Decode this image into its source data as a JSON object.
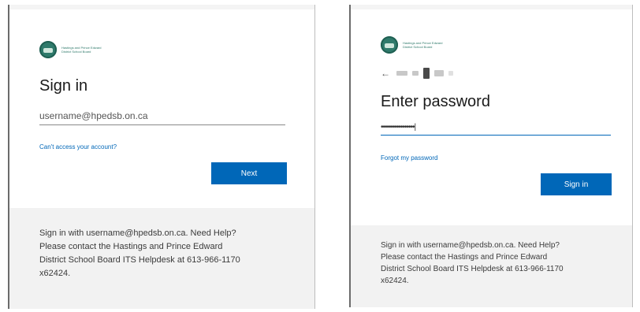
{
  "left_dialog": {
    "logo": {
      "icon": "school-board-logo-icon",
      "lines": [
        "Hastings and Prince Edward",
        "District School Board"
      ]
    },
    "title": "Sign in",
    "username_value": "username@hpedsb.on.ca",
    "cant_access_link": "Can't access your account?",
    "next_button": "Next",
    "footer_lines": [
      "Sign in with username@hpedsb.on.ca. Need Help?",
      "Please contact the Hastings and Prince Edward",
      "District School Board ITS Helpdesk at 613-966-1170",
      "x62424."
    ]
  },
  "right_dialog": {
    "logo": {
      "icon": "school-board-logo-icon",
      "lines": [
        "Hastings and Prince Edward",
        "District School Board"
      ]
    },
    "back_arrow": "←",
    "title": "Enter password",
    "password_value": "•••••••••••••••••",
    "forgot_password_link": "Forgot my password",
    "sign_in_button": "Sign in",
    "footer_lines": [
      "Sign in with username@hpedsb.on.ca. Need Help?",
      "Please contact the Hastings and Prince Edward",
      "District School Board ITS Helpdesk at 613-966-1170",
      "x62424."
    ]
  },
  "colors": {
    "accent": "#0067b8",
    "footer_bg": "#f2f2f2",
    "logo_green": "#2f7a6b"
  }
}
